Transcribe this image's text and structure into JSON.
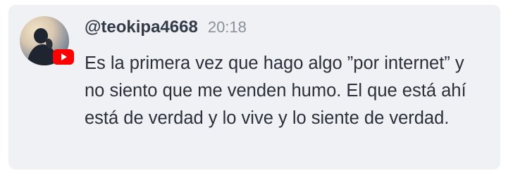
{
  "comment": {
    "handle": "@teokipa4668",
    "time": "20:18",
    "text": "Es la primera vez que hago algo ”por internet” y no siento que me venden humo. El que está ahí está de verdad y lo vive y lo siente de verdad.",
    "badge_icon": "youtube-icon",
    "colors": {
      "card_background": "#f0f1f4",
      "badge_red": "#ff0000"
    }
  }
}
